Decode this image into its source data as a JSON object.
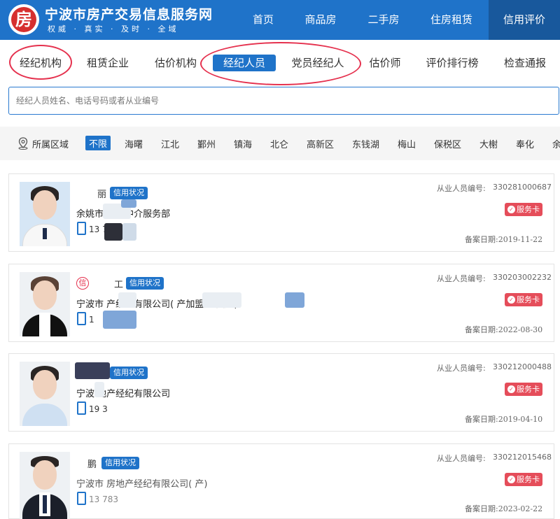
{
  "header": {
    "logo_char": "房",
    "title": "宁波市房产交易信息服务网",
    "slogan": "权威 · 真实 · 及时 · 全域",
    "nav": [
      "首页",
      "商品房",
      "二手房",
      "住房租赁",
      "信用评价"
    ]
  },
  "categories": [
    "经纪机构",
    "租赁企业",
    "估价机构",
    "经纪人员",
    "党员经纪人",
    "估价师",
    "评价排行榜",
    "检查通报"
  ],
  "search": {
    "placeholder": "经纪人员姓名、电话号码或者从业编号"
  },
  "region": {
    "label": "所属区域",
    "items": [
      "不限",
      "海曙",
      "江北",
      "鄞州",
      "镇海",
      "北仑",
      "高新区",
      "东钱湖",
      "梅山",
      "保税区",
      "大榭",
      "奉化",
      "余"
    ]
  },
  "agents": [
    {
      "name_visible": "丽",
      "credit_tag": "信用状况",
      "company": "余姚市 房产中介服务部",
      "phone": "13 7",
      "id_label": "从业人员编号:",
      "id": "330281000687",
      "service_card": "服务卡",
      "date": "备案日期:2019-11-22"
    },
    {
      "xin": "信",
      "name_visible": "工",
      "credit_tag": "信用状况",
      "company": "宁波市 产经纪有限公司( 产加盟店 园店)",
      "phone": "1",
      "id_label": "从业人员编号:",
      "id": "330203002232",
      "service_card": "服务卡",
      "date": "备案日期:2022-08-30"
    },
    {
      "credit_tag": "信用状况",
      "company": "宁波 地产经纪有限公司",
      "phone": "19 3",
      "id_label": "从业人员编号:",
      "id": "330212000488",
      "service_card": "服务卡",
      "date": "备案日期:2019-04-10"
    },
    {
      "name_visible": "鹏",
      "credit_tag": "信用状况",
      "company": "宁波市 房地产经纪有限公司( 产)",
      "phone": "13 783",
      "id_label": "从业人员编号:",
      "id": "330212015468",
      "service_card": "服务卡",
      "date": "备案日期:2023-02-22"
    }
  ]
}
